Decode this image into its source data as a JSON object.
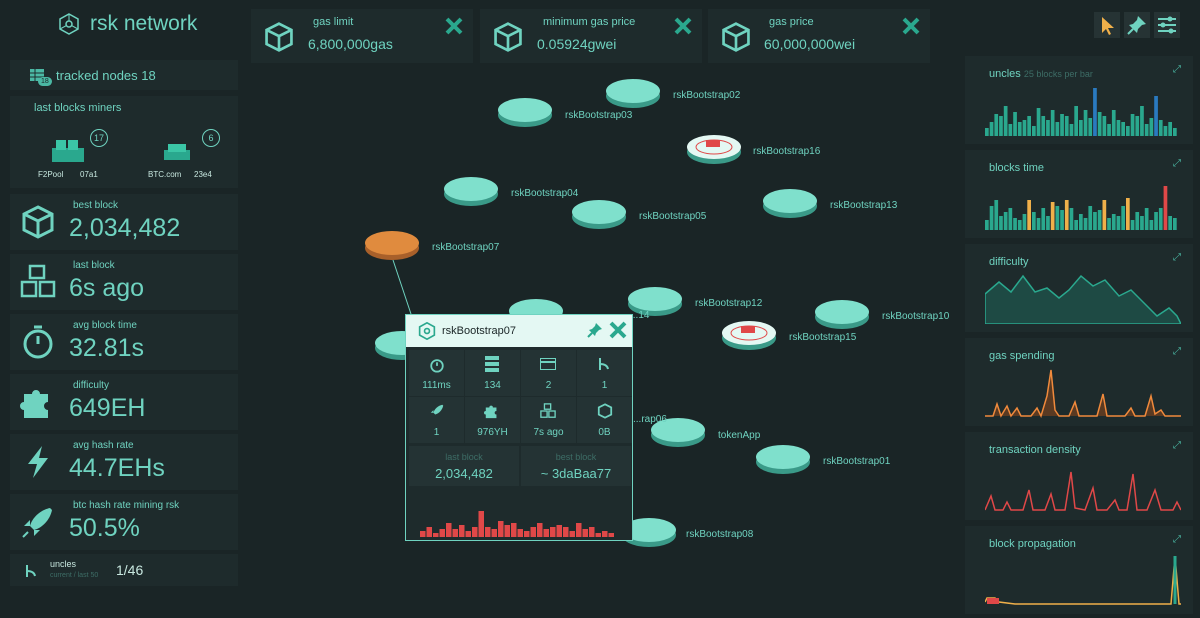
{
  "app": {
    "title": "rsk network"
  },
  "sidebar": {
    "tracked_nodes_label": "tracked nodes 18",
    "tracked_badge": "18",
    "miners_title": "last blocks miners",
    "miners": [
      {
        "name": "F2Pool",
        "hash": "07a1",
        "count": "17"
      },
      {
        "name": "BTC.com",
        "hash": "23e4",
        "count": "6"
      }
    ],
    "stats": [
      {
        "label": "best block",
        "value": "2,034,482",
        "icon": "cube-icon"
      },
      {
        "label": "last block",
        "value": "6s ago",
        "icon": "stacked-cubes-icon"
      },
      {
        "label": "avg block time",
        "value": "32.81s",
        "icon": "stopwatch-icon"
      },
      {
        "label": "difficulty",
        "value": "649EH",
        "icon": "puzzle-icon"
      },
      {
        "label": "avg hash rate",
        "value": "44.7EHs",
        "icon": "lightning-icon"
      },
      {
        "label": "btc hash rate mining rsk",
        "value": "50.5%",
        "icon": "rocket-icon"
      }
    ],
    "uncles": {
      "label": "uncles",
      "sublabel": "current / last 50",
      "value": "1/46"
    }
  },
  "top_cards": [
    {
      "label": "gas limit",
      "value": "6,800,000gas"
    },
    {
      "label": "minimum gas price",
      "value": "0.05924gwei"
    },
    {
      "label": "gas price",
      "value": "60,000,000wei"
    }
  ],
  "right_panels": [
    {
      "title": "uncles",
      "subtitle": "25 blocks per bar"
    },
    {
      "title": "blocks time",
      "subtitle": ""
    },
    {
      "title": "difficulty",
      "subtitle": ""
    },
    {
      "title": "gas spending",
      "subtitle": ""
    },
    {
      "title": "transaction density",
      "subtitle": ""
    },
    {
      "title": "block propagation",
      "subtitle": ""
    }
  ],
  "nodes": [
    {
      "name": "rskBootstrap02"
    },
    {
      "name": "rskBootstrap03"
    },
    {
      "name": "rskBootstrap16"
    },
    {
      "name": "rskBootstrap04"
    },
    {
      "name": "rskBootstrap05"
    },
    {
      "name": "rskBootstrap13"
    },
    {
      "name": "rskBootstrap07"
    },
    {
      "name": "rskBootstrap12"
    },
    {
      "name": "rskBootstrap10"
    },
    {
      "name": "rskBootstrap15"
    },
    {
      "name": "tokenApp"
    },
    {
      "name": "rskBootstrap01"
    },
    {
      "name": "rskBootstrap08"
    },
    {
      "name": "...14"
    },
    {
      "name": "...rap06"
    }
  ],
  "popup": {
    "name": "rskBootstrap07",
    "cells": [
      "111ms",
      "134",
      "2",
      "1",
      "1",
      "976YH",
      "7s ago",
      "0B"
    ],
    "last_block_label": "last block",
    "last_block_value": "2,034,482",
    "best_block_label": "best block",
    "best_block_value": "~ 3daBaa77"
  },
  "colors": {
    "accent": "#6fd3c0",
    "bg": "#1a2526",
    "panel": "#1e2b2c",
    "warning": "#f0b04a",
    "danger": "#e04848",
    "selected_node": "#e08b3e"
  }
}
